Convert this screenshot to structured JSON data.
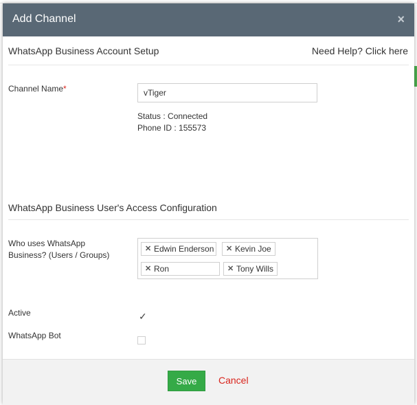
{
  "modal": {
    "title": "Add Channel",
    "close_label": "×"
  },
  "setup_section": {
    "title": "WhatsApp Business Account Setup",
    "help_link": "Need Help? Click here"
  },
  "channel_name": {
    "label": "Channel Name",
    "required_marker": "*",
    "value": "vTiger"
  },
  "status": {
    "status_text": "Status : Connected",
    "phone_text": "Phone ID : 155573"
  },
  "access_section": {
    "title": "WhatsApp Business User's Access Configuration",
    "users_label": "Who uses WhatsApp Business? (Users / Groups)",
    "tags": [
      "Edwin Enderson",
      "Kevin Joe",
      "Tony Wills"
    ],
    "typing_value": "Ron"
  },
  "active": {
    "label": "Active",
    "checked": true
  },
  "bot": {
    "label": "WhatsApp Bot",
    "checked": false
  },
  "footer": {
    "save_label": "Save",
    "cancel_label": "Cancel"
  },
  "colors": {
    "header_bg": "#596875",
    "save_green": "#35aa47",
    "cancel_red": "#d9241c",
    "required_red": "#d9241c"
  },
  "icons": {
    "close": "close-icon",
    "tag_remove": "remove-tag-icon",
    "check": "checkmark-icon"
  }
}
